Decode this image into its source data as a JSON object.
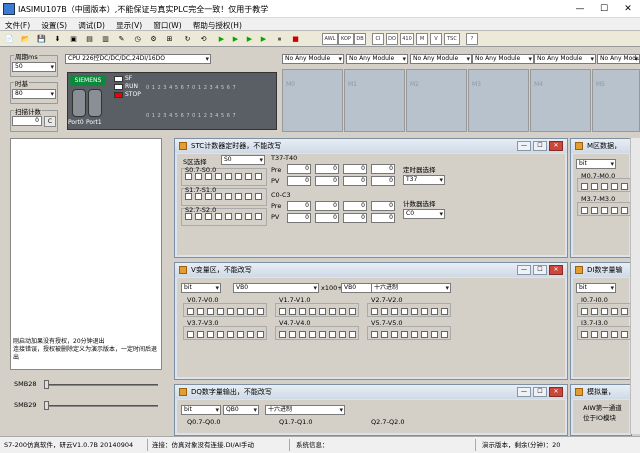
{
  "window": {
    "title": "IASIMU107B（中國版本）,不能保证与真实PLC完全一致！仅用于教学",
    "min": "—",
    "max": "☐",
    "close": "✕"
  },
  "menu": [
    "文件(F)",
    "设置(S)",
    "调试(D)",
    "显示(V)",
    "窗口(W)",
    "帮助与授权(H)"
  ],
  "toolbar": {
    "awl": "AWL",
    "kop": "KOP",
    "db": "DB",
    "ci": "CI",
    "do": "DO",
    "a10": "410",
    "m": "M",
    "v": "V",
    "tsc": "TSC",
    "help": "?"
  },
  "left": {
    "cycle_label": "周期ms",
    "cycle_value": "50",
    "timebase_label": "时基",
    "timebase_value": "80",
    "scan_label": "扫描计数",
    "scan_value": "0",
    "scan_btn": "C"
  },
  "cpu": {
    "model": "CPU 226控DC/DC/DC,24DI/16DO",
    "brand": "SIEMENS",
    "sf": "SF",
    "run": "RUN",
    "stop": "STOP",
    "io_top": "0 1 2 3 4 5 6 7 0 1 2 3 4 5 6 7",
    "io_bottom": "0 1 2 3 4 5 6 7 0 1 2 3 4 5 6 7",
    "port0": "Port0",
    "port1": "Port1"
  },
  "modules": {
    "label": "No Any Module",
    "slots": [
      "M0",
      "M1",
      "M2",
      "M3",
      "M4",
      "M5",
      "M6"
    ]
  },
  "memarea_text": "刚启动加果没有授权，20分钟退出\n连接错误，授权被删除定义为演示版本，一定时间后退出",
  "smb": {
    "smb28": "SMB28",
    "smb29": "SMB29"
  },
  "stc": {
    "title": "STC计数器定时器，不能改写",
    "s_select_label": "S区选择",
    "s_select_value": "S0",
    "s07": "S0.7-S0.0",
    "s17": "S1.7-S1.0",
    "s27": "S2.7-S2.0",
    "t_label": "T37-T40",
    "c_label": "C0-C3",
    "pre": "Pre",
    "pv": "PV",
    "zero": "0",
    "timer_sel_label": "定时器选择",
    "timer_sel_value": "T37",
    "counter_sel_label": "计数器选择",
    "counter_sel_value": "C0"
  },
  "mwin": {
    "title": "M区数据，",
    "sel": "bit",
    "m07": "M0.7-M0.0",
    "m37": "M3.7-M3.0"
  },
  "vwin": {
    "title": "V变量区，不能改写",
    "bit": "bit",
    "vb0a": "VB0",
    "x100": "x100+",
    "vb0b": "VB0",
    "hex": "十六进制",
    "v07": "V0.7-V0.0",
    "v17": "V1.7-V1.0",
    "v27": "V2.7-V2.0",
    "v37": "V3.7-V3.0",
    "v47": "V4.7-V4.0",
    "v57": "V5.7-V5.0"
  },
  "diwin": {
    "title": "DI数字量输",
    "sel": "bit",
    "i07": "I0.7-I0.0",
    "i37": "I3.7-I3.0"
  },
  "dqwin": {
    "title": "DQ数字量输出，不能改写",
    "bit": "bit",
    "qb0": "QB0",
    "hex": "十六进制",
    "q07": "Q0.7-Q0.0",
    "q17": "Q1.7-Q1.0",
    "q27": "Q2.7-Q2.0"
  },
  "aiwin": {
    "title": "模拟量，",
    "line1": "AIW第一通道",
    "line2": "位于IO模块"
  },
  "status": {
    "p1": "S7-200仿真软件，研云V1.0.7B 20140904",
    "p2": "连接：仿真对象没有连接.DI/AI手动",
    "p3": "系统信息：",
    "p4": "演示版本，剩余(分钟)：20"
  }
}
